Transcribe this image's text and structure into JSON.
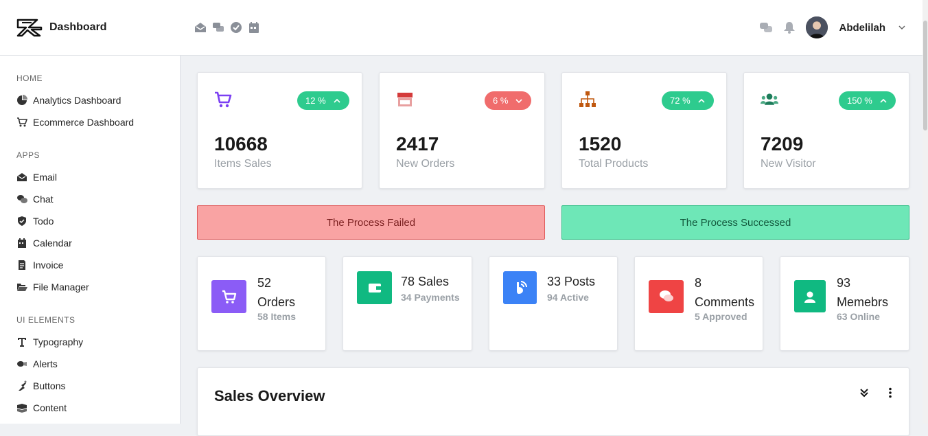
{
  "header": {
    "title": "Dashboard",
    "user_name": "Abdelilah",
    "top_icons": [
      "envelope-open-icon",
      "comments-icon",
      "check-badge-icon",
      "calendar-icon"
    ],
    "right_icons": [
      "chat-icon",
      "bell-icon"
    ]
  },
  "sidebar": {
    "sections": [
      {
        "title": "HOME",
        "items": [
          {
            "label": "Analytics Dashboard",
            "icon": "pie-chart-icon"
          },
          {
            "label": "Ecommerce Dashboard",
            "icon": "cart-icon"
          }
        ]
      },
      {
        "title": "APPS",
        "items": [
          {
            "label": "Email",
            "icon": "envelope-icon"
          },
          {
            "label": "Chat",
            "icon": "chat-icon"
          },
          {
            "label": "Todo",
            "icon": "shield-check-icon"
          },
          {
            "label": "Calendar",
            "icon": "calendar-icon"
          },
          {
            "label": "Invoice",
            "icon": "invoice-icon"
          },
          {
            "label": "File Manager",
            "icon": "folder-open-icon"
          }
        ]
      },
      {
        "title": "UI ELEMENTS",
        "items": [
          {
            "label": "Typography",
            "icon": "text-icon"
          },
          {
            "label": "Alerts",
            "icon": "alert-icon"
          },
          {
            "label": "Buttons",
            "icon": "hand-pointer-icon"
          },
          {
            "label": "Content",
            "icon": "content-icon"
          }
        ]
      }
    ]
  },
  "stats": [
    {
      "value": "10668",
      "label": "Items Sales",
      "badge": "12 %",
      "trend": "up",
      "badge_color": "#2ecb8e",
      "icon": "cart-icon",
      "icon_color": "#7b3ff2"
    },
    {
      "value": "2417",
      "label": "New Orders",
      "badge": "6 %",
      "trend": "down",
      "badge_color": "#f06c6c",
      "icon": "store-icon",
      "icon_color": "#d43a3a"
    },
    {
      "value": "1520",
      "label": "Total Products",
      "badge": "72 %",
      "trend": "up",
      "badge_color": "#2ecb8e",
      "icon": "sitemap-icon",
      "icon_color": "#c0580f"
    },
    {
      "value": "7209",
      "label": "New Visitor",
      "badge": "150 %",
      "trend": "up",
      "badge_color": "#2ecb8e",
      "icon": "users-icon",
      "icon_color": "#1d7c5a"
    }
  ],
  "alerts": {
    "failed": "The Process Failed",
    "success": "The Process Successed",
    "failed_color": "#f9a3a3",
    "success_color": "#6ee7b7"
  },
  "mini_cards": [
    {
      "line1": "52",
      "line2": "Orders",
      "sub": "58 Items",
      "color": "#8b5cf6",
      "icon": "cart-icon"
    },
    {
      "line1": "78 Sales",
      "line2": "",
      "sub": "34 Payments",
      "color": "#10b981",
      "icon": "wallet-icon"
    },
    {
      "line1": "33 Posts",
      "line2": "",
      "sub": "94 Active",
      "color": "#3b82f6",
      "icon": "blogger-icon"
    },
    {
      "line1": "8",
      "line2": "Comments",
      "sub": "5 Approved",
      "color": "#ef4444",
      "icon": "comments-icon"
    },
    {
      "line1": "93",
      "line2": "Memebrs",
      "sub": "63 Online",
      "color": "#10b981",
      "icon": "user-icon"
    }
  ],
  "sales": {
    "title": "Sales Overview"
  }
}
